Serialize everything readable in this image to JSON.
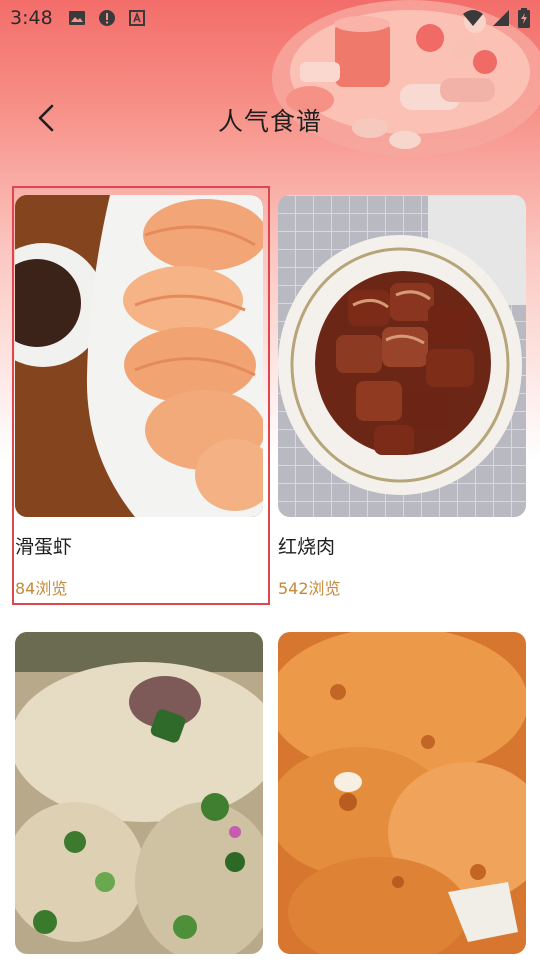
{
  "status_bar": {
    "time": "3:48",
    "left_icons": [
      "image-icon",
      "alert-icon",
      "a-box-icon"
    ],
    "right_icons": [
      "wifi-icon",
      "signal-icon",
      "battery-charging-icon"
    ]
  },
  "header": {
    "title": "人气食谱",
    "back_icon": "back-chevron-icon"
  },
  "recipes": [
    {
      "name": "滑蛋虾",
      "views": "84浏览",
      "selected": true
    },
    {
      "name": "红烧肉",
      "views": "542浏览",
      "selected": false
    },
    {
      "name": "",
      "views": ""
    },
    {
      "name": "",
      "views": ""
    }
  ],
  "colors": {
    "header_gradient_top": "#f36d6a",
    "views_text": "#c58a3a",
    "selection_border": "#e0474c"
  }
}
